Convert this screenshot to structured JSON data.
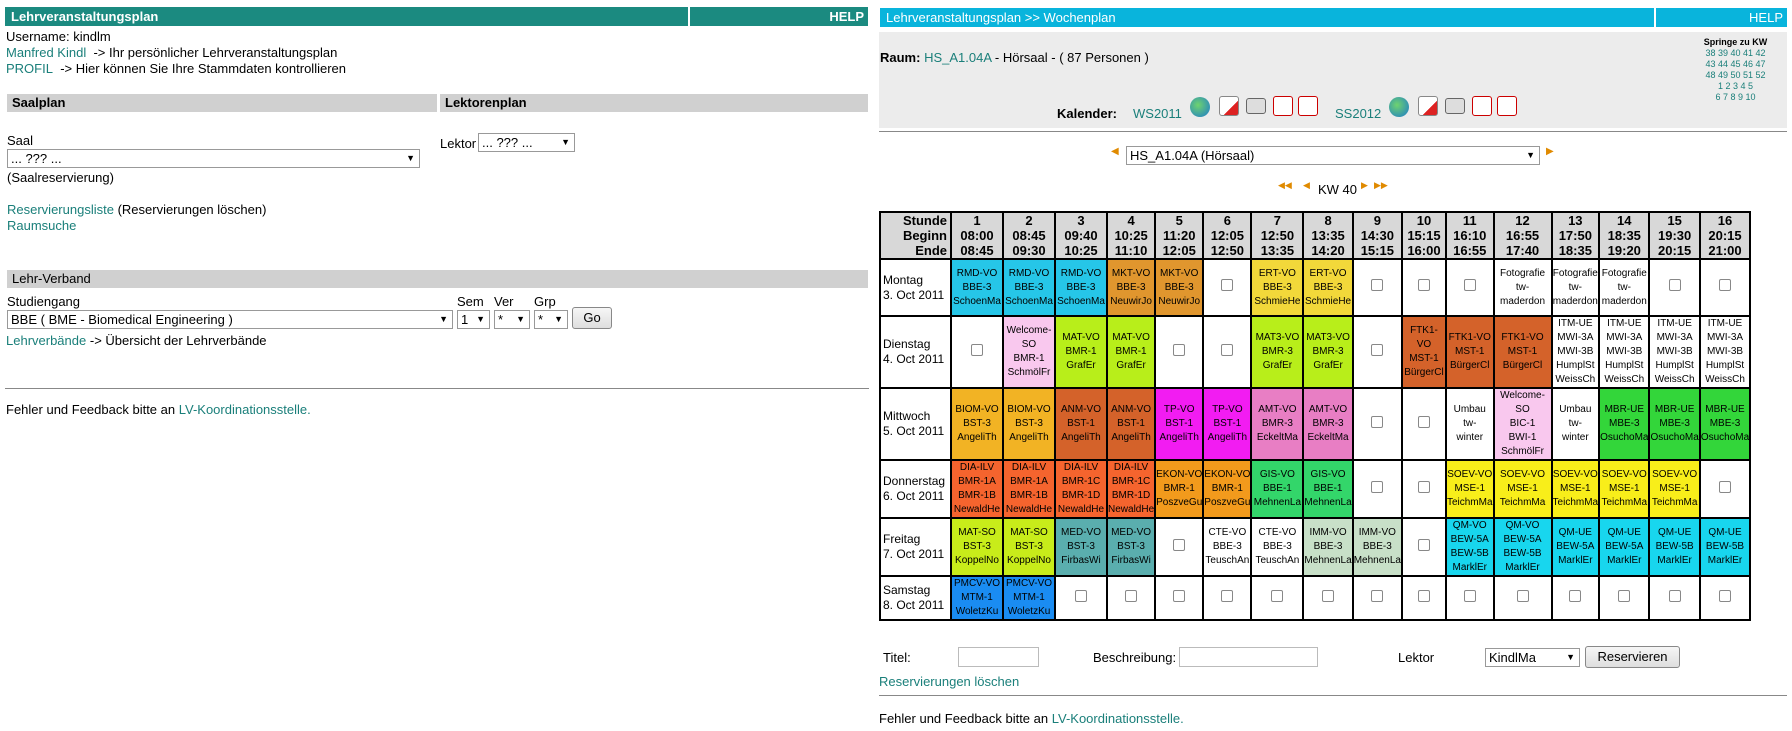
{
  "left": {
    "title": "Lehrveranstaltungsplan",
    "help": "HELP",
    "username": "Username: kindlm",
    "user_link": "Manfred Kindl",
    "user_text": "-> Ihr persönlicher Lehrveranstaltungsplan",
    "profil_link": "PROFIL",
    "profil_text": "-> Hier können Sie Ihre Stammdaten kontrollieren",
    "saalplan": "Saalplan",
    "lektorenplan": "Lektorenplan",
    "saal_label": "Saal",
    "saal_value": "... ??? ...",
    "saal_note": "(Saalreservierung)",
    "lektor_label": "Lektor",
    "lektor_value": "... ??? ...",
    "res_link": "Reservierungsliste",
    "res_text": "(Reservierungen löschen)",
    "raumsuche": "Raumsuche",
    "lehrverband": "Lehr-Verband",
    "studiengang_label": "Studiengang",
    "studiengang_value": "BBE ( BME - Biomedical Engineering )",
    "sem_label": "Sem",
    "sem_value": "1",
    "ver_label": "Ver",
    "ver_value": "*",
    "grp_label": "Grp",
    "grp_value": "*",
    "go": "Go",
    "lv_link": "Lehrverbände",
    "lv_text": "-> Übersicht der Lehrverbände",
    "feedback_text": "Fehler und Feedback bitte an",
    "feedback_link": "LV-Koordinationsstelle."
  },
  "right": {
    "title": "Lehrveranstaltungsplan >> Wochenplan",
    "help": "HELP",
    "raum_label": "Raum:",
    "raum_link": "HS_A1.04A",
    "raum_text": "- Hörsaal - ( 87 Personen )",
    "kalender_label": "Kalender:",
    "ws": "WS2011",
    "ss": "SS2012",
    "springe": "Springe zu KW",
    "kw_rows": [
      "38 39 40 41 42",
      "43 44 45 46 47",
      "48 49 50 51 52",
      "1 2 3 4 5",
      "6 7 8 9 10"
    ],
    "room_select": "HS_A1.04A (Hörsaal)",
    "kw": "KW 40",
    "titel_label": "Titel:",
    "beschreibung_label": "Beschreibung:",
    "lektor_label": "Lektor",
    "lektor_value": "KindlMa",
    "reservieren": "Reservieren",
    "res_loeschen": "Reservierungen löschen",
    "feedback_text": "Fehler und Feedback bitte an",
    "feedback_link": "LV-Koordinationsstelle."
  },
  "grid": {
    "header_label": [
      "Stunde",
      "Beginn",
      "Ende"
    ],
    "slots": [
      [
        "1",
        "08:00",
        "08:45"
      ],
      [
        "2",
        "08:45",
        "09:30"
      ],
      [
        "3",
        "09:40",
        "10:25"
      ],
      [
        "4",
        "10:25",
        "11:10"
      ],
      [
        "5",
        "11:20",
        "12:05"
      ],
      [
        "6",
        "12:05",
        "12:50"
      ],
      [
        "7",
        "12:50",
        "13:35"
      ],
      [
        "8",
        "13:35",
        "14:20"
      ],
      [
        "9",
        "14:30",
        "15:15"
      ],
      [
        "10",
        "15:15",
        "16:00"
      ],
      [
        "11",
        "16:10",
        "16:55"
      ],
      [
        "12",
        "16:55",
        "17:40"
      ],
      [
        "13",
        "17:50",
        "18:35"
      ],
      [
        "14",
        "18:35",
        "19:20"
      ],
      [
        "15",
        "19:30",
        "20:15"
      ],
      [
        "16",
        "20:15",
        "21:00"
      ]
    ],
    "days": [
      {
        "name": "Montag",
        "date": "3. Oct 2011",
        "cells": [
          [
            "#26c6e8",
            "RMD-VO",
            "BBE-3",
            "SchoenMa"
          ],
          [
            "#26c6e8",
            "RMD-VO",
            "BBE-3",
            "SchoenMa"
          ],
          [
            "#26c6e8",
            "RMD-VO",
            "BBE-3",
            "SchoenMa"
          ],
          [
            "#e0962e",
            "MKT-VO",
            "BBE-3",
            "NeuwirJo"
          ],
          [
            "#e0962e",
            "MKT-VO",
            "BBE-3",
            "NeuwirJo"
          ],
          null,
          [
            "#f2d83a",
            "ERT-VO",
            "BBE-3",
            "SchmieHe"
          ],
          [
            "#f2d83a",
            "ERT-VO",
            "BBE-3",
            "SchmieHe"
          ],
          null,
          null,
          null,
          [
            "#ffffff",
            "Fotografie",
            "tw-",
            "maderdon"
          ],
          [
            "#ffffff",
            "Fotografie",
            "tw-",
            "maderdon"
          ],
          [
            "#ffffff",
            "Fotografie",
            "tw-",
            "maderdon"
          ],
          null,
          null
        ]
      },
      {
        "name": "Dienstag",
        "date": "4. Oct 2011",
        "cells": [
          null,
          [
            "#f9c8ee",
            "Welcome-SO",
            "BMR-1",
            "SchmölFr"
          ],
          [
            "#b8ee1a",
            "MAT-VO",
            "BMR-1",
            "GrafEr"
          ],
          [
            "#b8ee1a",
            "MAT-VO",
            "BMR-1",
            "GrafEr"
          ],
          null,
          null,
          [
            "#b8ee1a",
            "MAT3-VO",
            "BMR-3",
            "GrafEr"
          ],
          [
            "#b8ee1a",
            "MAT3-VO",
            "BMR-3",
            "GrafEr"
          ],
          null,
          [
            "#d4622a",
            "FTK1-VO",
            "MST-1",
            "BürgerCl"
          ],
          [
            "#d4622a",
            "FTK1-VO",
            "MST-1",
            "BürgerCl"
          ],
          [
            "#d4622a",
            "FTK1-VO",
            "MST-1",
            "BürgerCl"
          ],
          [
            "#ffffff",
            "ITM-UE",
            "MWI-3A",
            "MWI-3B",
            "HumplSt",
            "WeissCh"
          ],
          [
            "#ffffff",
            "ITM-UE",
            "MWI-3A",
            "MWI-3B",
            "HumplSt",
            "WeissCh"
          ],
          [
            "#ffffff",
            "ITM-UE",
            "MWI-3A",
            "MWI-3B",
            "HumplSt",
            "WeissCh"
          ],
          [
            "#ffffff",
            "ITM-UE",
            "MWI-3A",
            "MWI-3B",
            "HumplSt",
            "WeissCh"
          ]
        ]
      },
      {
        "name": "Mittwoch",
        "date": "5. Oct 2011",
        "cells": [
          [
            "#f2b324",
            "BIOM-VO",
            "BST-3",
            "AngeliTh"
          ],
          [
            "#f2b324",
            "BIOM-VO",
            "BST-3",
            "AngeliTh"
          ],
          [
            "#d4622a",
            "ANM-VO",
            "BST-1",
            "AngeliTh"
          ],
          [
            "#d4622a",
            "ANM-VO",
            "BST-1",
            "AngeliTh"
          ],
          [
            "#f21cf2",
            "TP-VO",
            "BST-1",
            "AngeliTh"
          ],
          [
            "#f21cf2",
            "TP-VO",
            "BST-1",
            "AngeliTh"
          ],
          [
            "#e87ec4",
            "AMT-VO",
            "BMR-3",
            "EckeltMa"
          ],
          [
            "#e87ec4",
            "AMT-VO",
            "BMR-3",
            "EckeltMa"
          ],
          null,
          null,
          [
            "#ffffff",
            "Umbau",
            "tw-",
            "winter"
          ],
          [
            "#f9c8ee",
            "Welcome-SO",
            "BIC-1",
            "BWI-1",
            "SchmölFr"
          ],
          [
            "#ffffff",
            "Umbau",
            "tw-",
            "winter"
          ],
          [
            "#33d63a",
            "MBR-UE",
            "MBE-3",
            "OsuchoMa"
          ],
          [
            "#33d63a",
            "MBR-UE",
            "MBE-3",
            "OsuchoMa"
          ],
          [
            "#33d63a",
            "MBR-UE",
            "MBE-3",
            "OsuchoMa"
          ]
        ]
      },
      {
        "name": "Donnerstag",
        "date": "6. Oct 2011",
        "cells": [
          [
            "#f5642e",
            "DIA-ILV",
            "BMR-1A",
            "BMR-1B",
            "NewaldHe"
          ],
          [
            "#f5642e",
            "DIA-ILV",
            "BMR-1A",
            "BMR-1B",
            "NewaldHe"
          ],
          [
            "#f5642e",
            "DIA-ILV",
            "BMR-1C",
            "BMR-1D",
            "NewaldHe"
          ],
          [
            "#f5642e",
            "DIA-ILV",
            "BMR-1C",
            "BMR-1D",
            "NewaldHe"
          ],
          [
            "#f29a1c",
            "EKON-VO",
            "BMR-1",
            "PoszveGu"
          ],
          [
            "#f29a1c",
            "EKON-VO",
            "BMR-1",
            "PoszveGu"
          ],
          [
            "#33d66a",
            "GIS-VO",
            "BBE-1",
            "MehnenLa"
          ],
          [
            "#33d66a",
            "GIS-VO",
            "BBE-1",
            "MehnenLa"
          ],
          null,
          null,
          [
            "#f8ee1a",
            "SOEV-VO",
            "MSE-1",
            "TeichmMa"
          ],
          [
            "#f8ee1a",
            "SOEV-VO",
            "MSE-1",
            "TeichmMa"
          ],
          [
            "#f8ee1a",
            "SOEV-VO",
            "MSE-1",
            "TeichmMa"
          ],
          [
            "#f8ee1a",
            "SOEV-VO",
            "MSE-1",
            "TeichmMa"
          ],
          [
            "#f8ee1a",
            "SOEV-VO",
            "MSE-1",
            "TeichmMa"
          ],
          null
        ]
      },
      {
        "name": "Freitag",
        "date": "7. Oct 2011",
        "cells": [
          [
            "#c8ec1a",
            "MAT-SO",
            "BST-3",
            "KoppelNo"
          ],
          [
            "#c8ec1a",
            "MAT-SO",
            "BST-3",
            "KoppelNo"
          ],
          [
            "#5aaeae",
            "MED-VO",
            "BST-3",
            "FirbasWi"
          ],
          [
            "#5aaeae",
            "MED-VO",
            "BST-3",
            "FirbasWi"
          ],
          null,
          [
            "#ffffff",
            "CTE-VO",
            "BBE-3",
            "TeuschAn"
          ],
          [
            "#ffffff",
            "CTE-VO",
            "BBE-3",
            "TeuschAn"
          ],
          [
            "#c8e0c8",
            "IMM-VO",
            "BBE-3",
            "MehnenLa"
          ],
          [
            "#c8e0c8",
            "IMM-VO",
            "BBE-3",
            "MehnenLa"
          ],
          null,
          [
            "#18d6ee",
            "QM-VO",
            "BEW-5A",
            "BEW-5B",
            "MarklEr"
          ],
          [
            "#18d6ee",
            "QM-VO",
            "BEW-5A",
            "BEW-5B",
            "MarklEr"
          ],
          [
            "#18d6ee",
            "QM-UE",
            "BEW-5A",
            "MarklEr"
          ],
          [
            "#18d6ee",
            "QM-UE",
            "BEW-5A",
            "MarklEr"
          ],
          [
            "#18d6ee",
            "QM-UE",
            "BEW-5B",
            "MarklEr"
          ],
          [
            "#18d6ee",
            "QM-UE",
            "BEW-5B",
            "MarklEr"
          ]
        ]
      },
      {
        "name": "Samstag",
        "date": "8. Oct 2011",
        "cells": [
          [
            "#1a8cf2",
            "PMCV-VO",
            "MTM-1",
            "WoletzKu"
          ],
          [
            "#1a8cf2",
            "PMCV-VO",
            "MTM-1",
            "WoletzKu"
          ],
          null,
          null,
          null,
          null,
          null,
          null,
          null,
          null,
          null,
          null,
          null,
          null,
          null,
          null
        ]
      }
    ]
  }
}
